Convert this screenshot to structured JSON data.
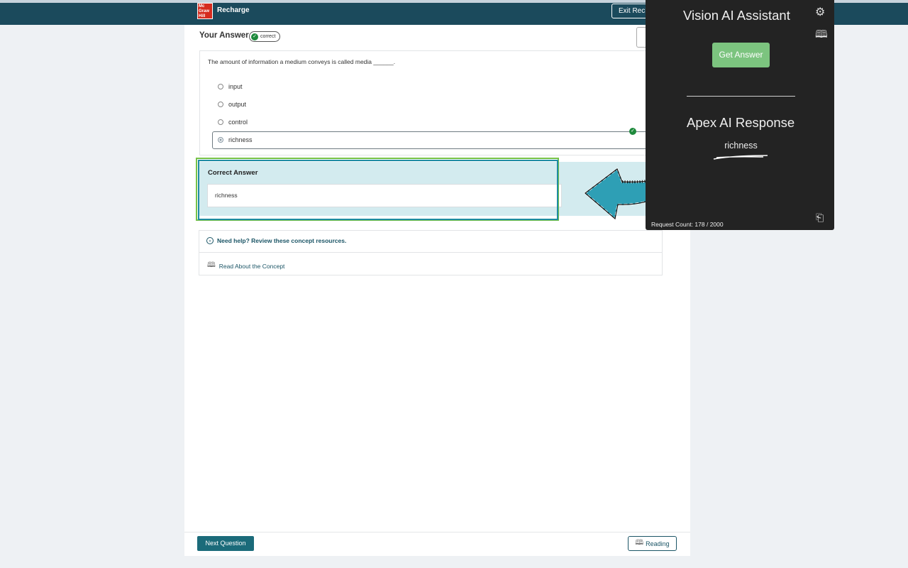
{
  "header": {
    "logo_text": "Mc Graw Hill",
    "app_title": "Recharge",
    "exit_label": "Exit Rech"
  },
  "answer": {
    "label": "Your Answer",
    "status_badge": "correct"
  },
  "question": {
    "text": "The amount of information a medium conveys is called media ______.",
    "options": [
      {
        "label": "input",
        "selected": false
      },
      {
        "label": "output",
        "selected": false
      },
      {
        "label": "control",
        "selected": false
      },
      {
        "label": "richness",
        "selected": true
      }
    ]
  },
  "correct_answer": {
    "title": "Correct Answer",
    "value": "richness"
  },
  "help": {
    "title": "Need help? Review these concept resources.",
    "link": "Read About the Concept"
  },
  "footer": {
    "next_label": "Next Question",
    "reading_label": "Reading"
  },
  "ai_panel": {
    "title": "Vision AI Assistant",
    "get_answer_label": "Get Answer",
    "response_title": "Apex AI Response",
    "response": "richness",
    "request_count": "Request Count: 178 / 2000"
  },
  "colors": {
    "header_bg": "#1b4a5c",
    "accent_teal": "#1b6b7a",
    "correct_green": "#1e8a3c",
    "get_answer_green": "#7cc47f",
    "panel_bg": "#232323",
    "highlight_green": "#76c248",
    "highlight_teal": "#1f8ca3"
  },
  "icons": [
    "check-icon",
    "gear-icon",
    "book-icon",
    "exit-icon",
    "chevron-down-icon",
    "arrow-icon"
  ]
}
